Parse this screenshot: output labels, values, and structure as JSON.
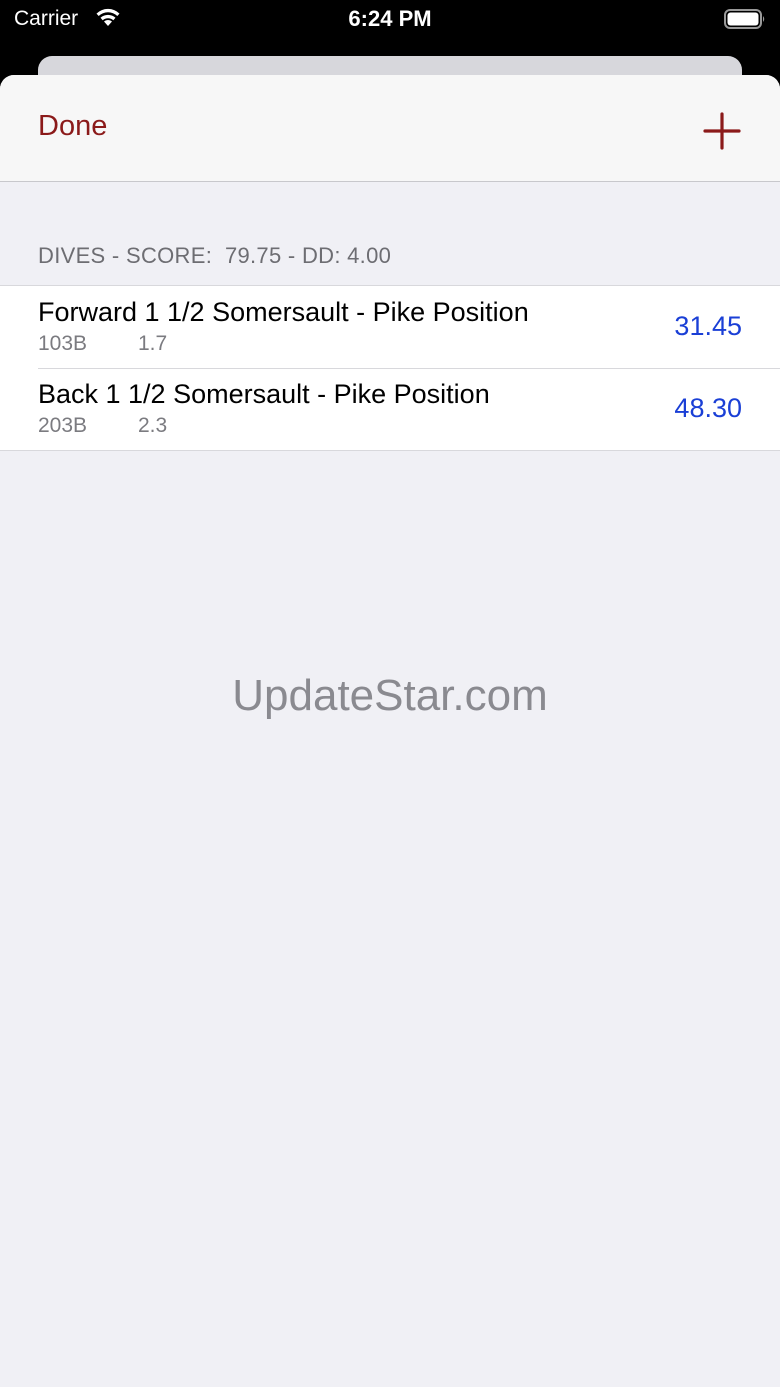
{
  "status_bar": {
    "carrier": "Carrier",
    "time": "6:24 PM"
  },
  "nav": {
    "done_label": "Done",
    "add_icon": "plus-icon",
    "accent_color": "#8b1a1a"
  },
  "section": {
    "header": "DIVES - SCORE:  79.75 - DD: 4.00"
  },
  "dives": [
    {
      "name": "Forward 1 1/2 Somersault - Pike Position",
      "code": "103B",
      "dd": "1.7",
      "score": "31.45"
    },
    {
      "name": "Back 1 1/2 Somersault - Pike Position",
      "code": "203B",
      "dd": "2.3",
      "score": "48.30"
    }
  ],
  "watermark": "UpdateStar.com",
  "colors": {
    "score": "#1a3fd6",
    "background": "#f0f0f5"
  }
}
